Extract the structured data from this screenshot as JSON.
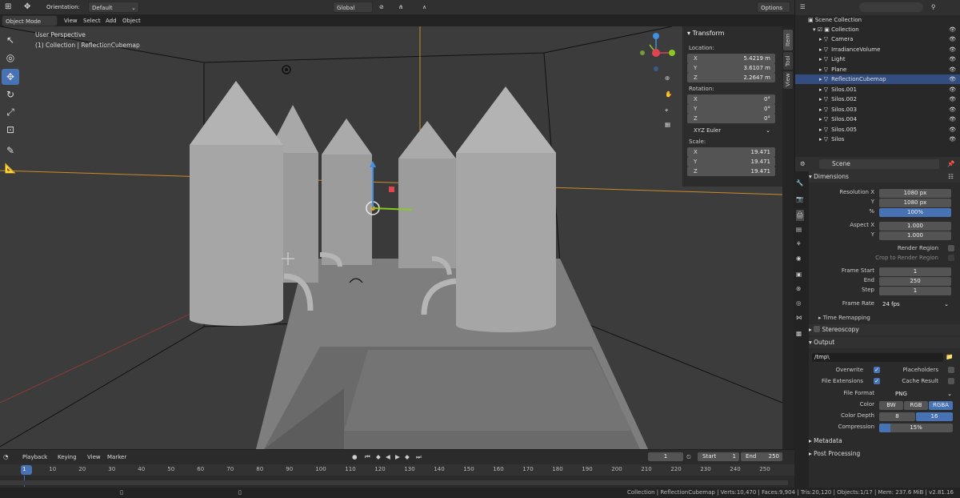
{
  "topbar": {
    "orientation_label": "Orientation:",
    "orientation_value": "Default",
    "transform_space": "Global",
    "options": "Options"
  },
  "menubar": {
    "mode": "Object Mode",
    "items": [
      "View",
      "Select",
      "Add",
      "Object"
    ]
  },
  "viewport": {
    "perspective": "User Perspective",
    "context": "(1) Collection | ReflectionCubemap"
  },
  "npanel": {
    "header": "Transform",
    "location_label": "Location:",
    "location": [
      {
        "axis": "X",
        "value": "5.4219 m"
      },
      {
        "axis": "Y",
        "value": "3.6107 m"
      },
      {
        "axis": "Z",
        "value": "2.2647 m"
      }
    ],
    "rotation_label": "Rotation:",
    "rotation": [
      {
        "axis": "X",
        "value": "0°"
      },
      {
        "axis": "Y",
        "value": "0°"
      },
      {
        "axis": "Z",
        "value": "0°"
      }
    ],
    "rotation_mode": "XYZ Euler",
    "scale_label": "Scale:",
    "scale": [
      {
        "axis": "X",
        "value": "19.471"
      },
      {
        "axis": "Y",
        "value": "19.471"
      },
      {
        "axis": "Z",
        "value": "19.471"
      }
    ]
  },
  "sidetabs": [
    "Item",
    "Tool",
    "View"
  ],
  "outliner": {
    "root": "Scene Collection",
    "collection": "Collection",
    "items": [
      {
        "name": "Camera",
        "selected": false
      },
      {
        "name": "IrradianceVolume",
        "selected": false
      },
      {
        "name": "Light",
        "selected": false
      },
      {
        "name": "Plane",
        "selected": false
      },
      {
        "name": "ReflectionCubemap",
        "selected": true
      },
      {
        "name": "Silos.001",
        "selected": false
      },
      {
        "name": "Silos.002",
        "selected": false
      },
      {
        "name": "Silos.003",
        "selected": false
      },
      {
        "name": "Silos.004",
        "selected": false
      },
      {
        "name": "Silos.005",
        "selected": false
      },
      {
        "name": "Silos",
        "selected": false
      }
    ]
  },
  "props": {
    "scene": "Scene",
    "dimensions": "Dimensions",
    "res_x_label": "Resolution X",
    "res_x": "1080 px",
    "res_y_label": "Y",
    "res_y": "1080 px",
    "pct_label": "%",
    "pct": "100%",
    "aspect_x_label": "Aspect X",
    "aspect_x": "1.000",
    "aspect_y_label": "Y",
    "aspect_y": "1.000",
    "render_region": "Render Region",
    "crop_region": "Crop to Render Region",
    "frame_start_label": "Frame Start",
    "frame_start": "1",
    "end_label": "End",
    "end": "250",
    "step_label": "Step",
    "step": "1",
    "frame_rate_label": "Frame Rate",
    "frame_rate": "24 fps",
    "time_remapping": "Time Remapping",
    "stereoscopy": "Stereoscopy",
    "output": "Output",
    "path": "/tmp\\",
    "overwrite": "Overwrite",
    "placeholders": "Placeholders",
    "file_ext": "File Extensions",
    "cache_result": "Cache Result",
    "file_format_label": "File Format",
    "file_format": "PNG",
    "color_label": "Color",
    "color_opts": [
      "BW",
      "RGB",
      "RGBA"
    ],
    "depth_label": "Color Depth",
    "depth_opts": [
      "8",
      "16"
    ],
    "compression_label": "Compression",
    "compression": "15%",
    "compression_fraction": 0.15,
    "metadata": "Metadata",
    "post_processing": "Post Processing"
  },
  "timeline": {
    "menus": [
      "Playback",
      "Keying",
      "View",
      "Marker"
    ],
    "current_frame": "1",
    "start_label": "Start",
    "start": "1",
    "end_label": "End",
    "end": "250",
    "ruler": [
      "1",
      "10",
      "20",
      "30",
      "40",
      "50",
      "60",
      "70",
      "80",
      "90",
      "100",
      "110",
      "120",
      "130",
      "140",
      "150",
      "160",
      "170",
      "180",
      "190",
      "200",
      "210",
      "220",
      "230",
      "240",
      "250"
    ]
  },
  "statusbar": {
    "text": "Collection | ReflectionCubemap | Verts:10,470 | Faces:9,904 | Tris:20,120 | Objects:1/17 | Mem: 237.6 MiB | v2.81.16"
  },
  "colors": {
    "accent": "#4772b3",
    "selected_row": "#334d80",
    "axis_x": "#e0444f",
    "axis_y": "#8ac924",
    "axis_z": "#3f8fe4",
    "object_origin": "#f0a12b"
  }
}
